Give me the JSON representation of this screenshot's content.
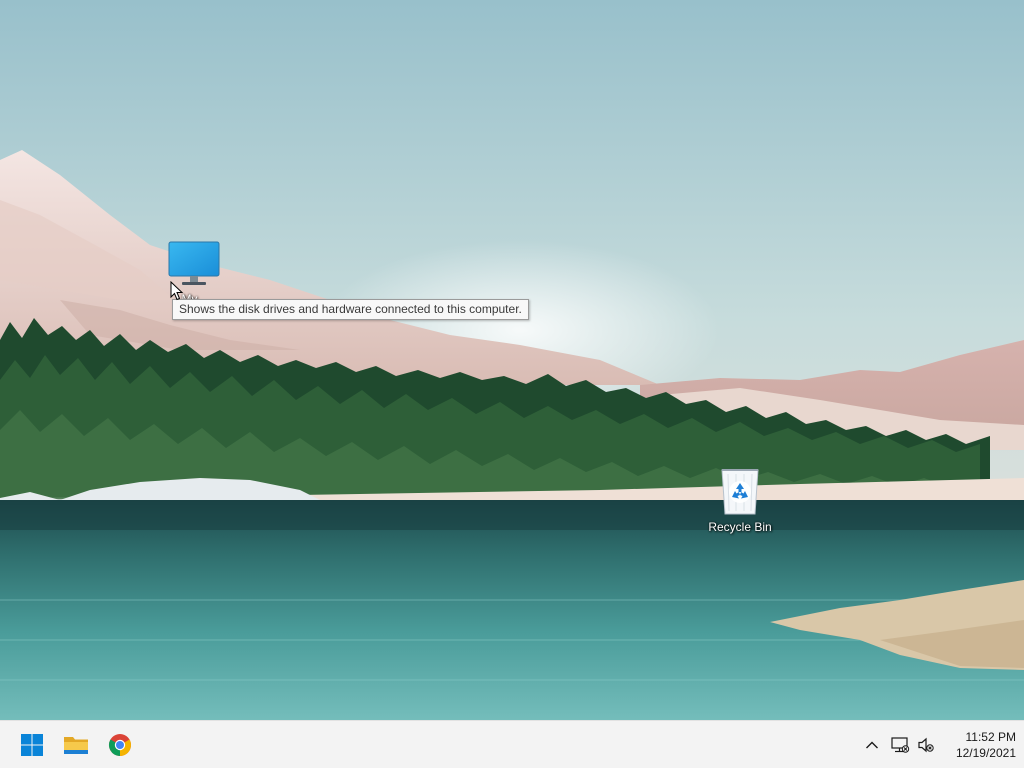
{
  "desktop": {
    "icons": [
      {
        "label": "My...",
        "icon": "monitor-icon"
      },
      {
        "label": "Recycle Bin",
        "icon": "recycle-bin-icon"
      }
    ],
    "tooltip": "Shows the disk drives and hardware connected to this computer."
  },
  "taskbar": {
    "apps": [
      {
        "icon": "windows-start-icon"
      },
      {
        "icon": "file-explorer-icon"
      },
      {
        "icon": "chrome-icon"
      }
    ],
    "tray": {
      "icons": [
        "chevron-up-icon",
        "network-icon",
        "volume-muted-icon"
      ]
    },
    "clock": {
      "time": "11:52 PM",
      "date": "12/19/2021"
    }
  },
  "colors": {
    "taskbar": "#f3f3f3",
    "windows_blue": "#0078d4",
    "folder_yellow": "#f0c040"
  }
}
